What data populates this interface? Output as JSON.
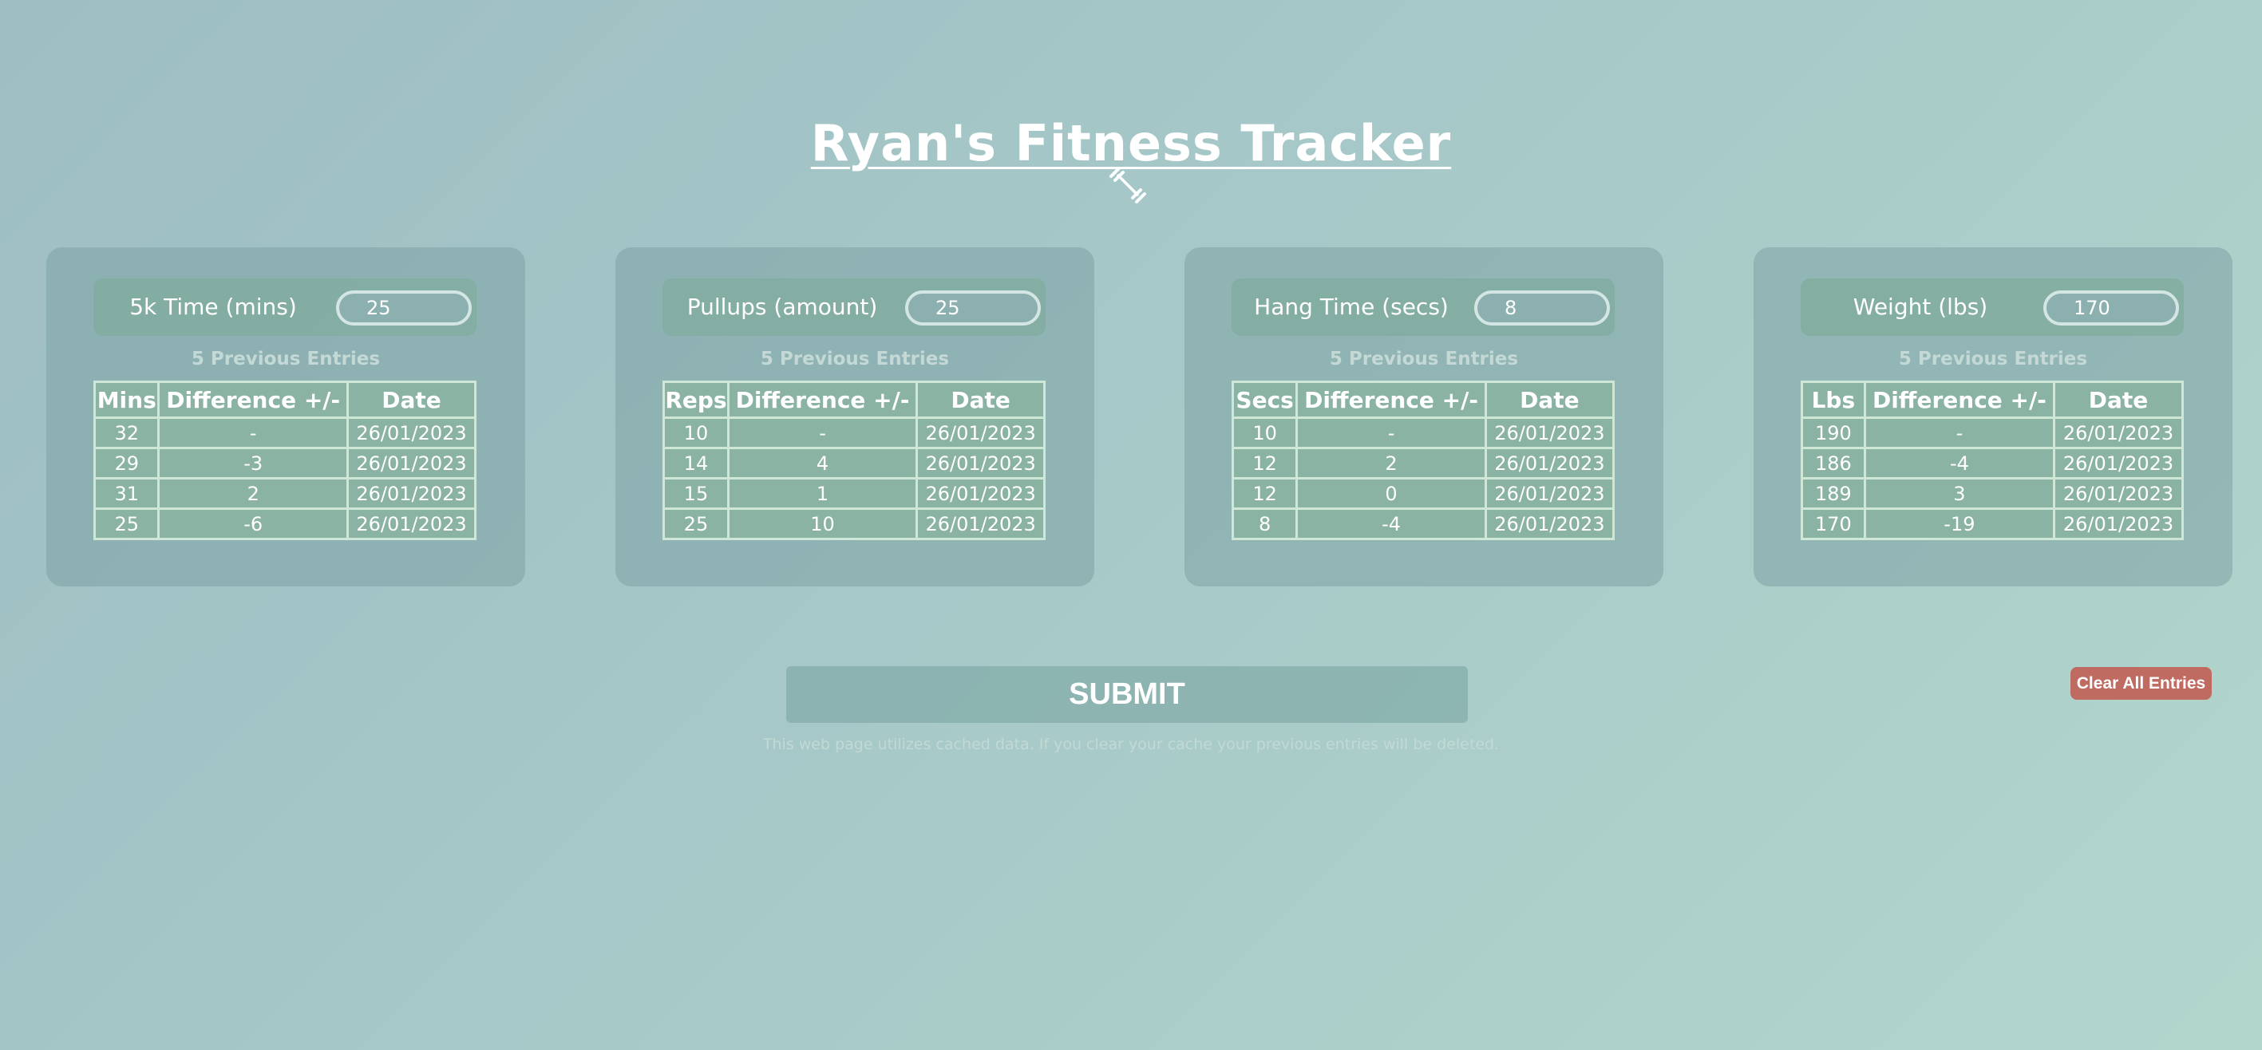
{
  "page": {
    "title": "Ryan's Fitness Tracker",
    "logo_icon": "dumbbell-icon"
  },
  "cards": [
    {
      "label": "5k Time (mins)",
      "input_value": "25",
      "previous_heading": "5 Previous Entries",
      "headers": [
        "Mins",
        "Difference +/-",
        "Date"
      ],
      "rows": [
        [
          "32",
          "-",
          "26/01/2023"
        ],
        [
          "29",
          "-3",
          "26/01/2023"
        ],
        [
          "31",
          "2",
          "26/01/2023"
        ],
        [
          "25",
          "-6",
          "26/01/2023"
        ]
      ]
    },
    {
      "label": "Pullups (amount)",
      "input_value": "25",
      "previous_heading": "5 Previous Entries",
      "headers": [
        "Reps",
        "Difference +/-",
        "Date"
      ],
      "rows": [
        [
          "10",
          "-",
          "26/01/2023"
        ],
        [
          "14",
          "4",
          "26/01/2023"
        ],
        [
          "15",
          "1",
          "26/01/2023"
        ],
        [
          "25",
          "10",
          "26/01/2023"
        ]
      ]
    },
    {
      "label": "Hang Time (secs)",
      "input_value": "8",
      "previous_heading": "5 Previous Entries",
      "headers": [
        "Secs",
        "Difference +/-",
        "Date"
      ],
      "rows": [
        [
          "10",
          "-",
          "26/01/2023"
        ],
        [
          "12",
          "2",
          "26/01/2023"
        ],
        [
          "12",
          "0",
          "26/01/2023"
        ],
        [
          "8",
          "-4",
          "26/01/2023"
        ]
      ]
    },
    {
      "label": "Weight (lbs)",
      "input_value": "170",
      "previous_heading": "5 Previous Entries",
      "headers": [
        "Lbs",
        "Difference +/-",
        "Date"
      ],
      "rows": [
        [
          "190",
          "-",
          "26/01/2023"
        ],
        [
          "186",
          "-4",
          "26/01/2023"
        ],
        [
          "189",
          "3",
          "26/01/2023"
        ],
        [
          "170",
          "-19",
          "26/01/2023"
        ]
      ]
    }
  ],
  "submit_label": "SUBMIT",
  "clear_label": "Clear All Entries",
  "cache_note": "This web page utilizes cached data. If you clear your cache your previous entries will be deleted.",
  "colors": {
    "clear_button": "#bf6b62",
    "table_fill": "#8bb3a4",
    "table_border": "#cfe7d7"
  }
}
